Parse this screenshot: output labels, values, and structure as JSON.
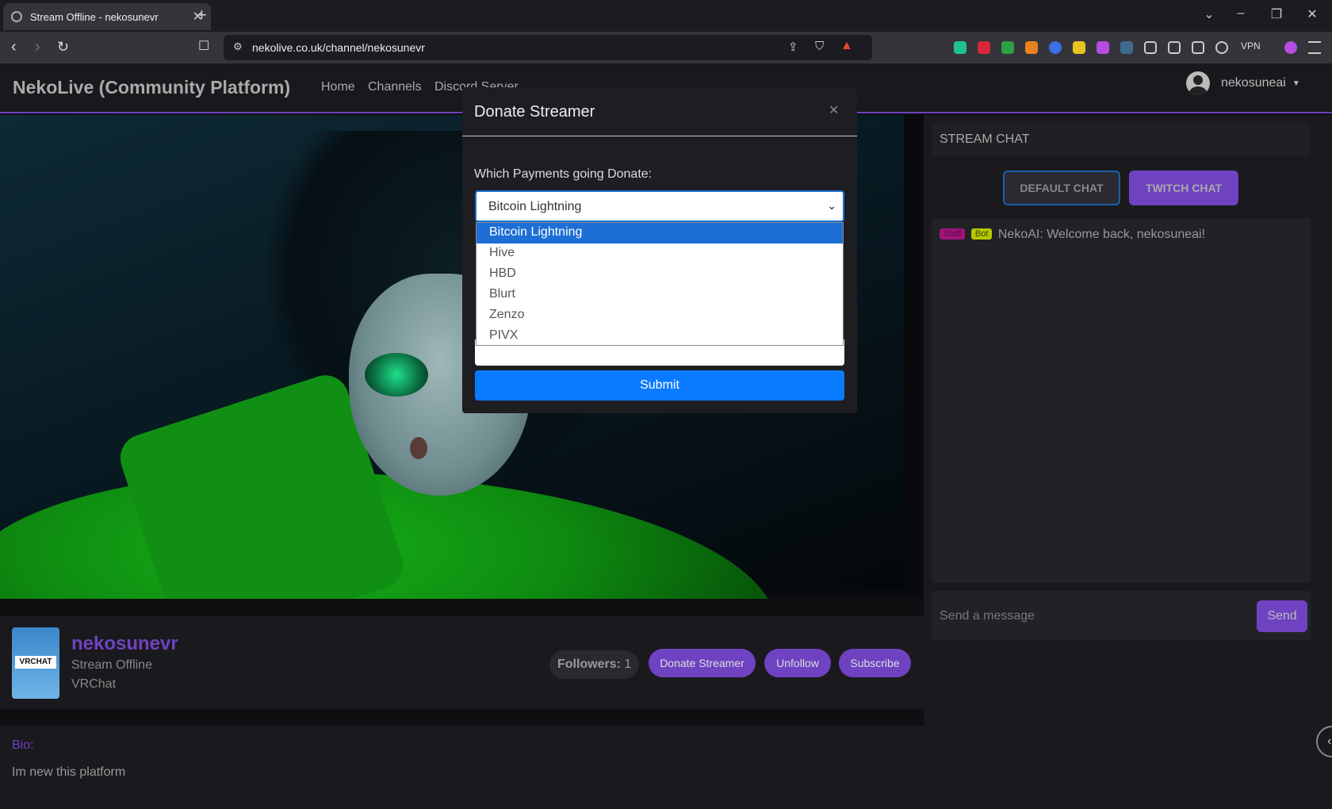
{
  "browser": {
    "tab_title": "Stream Offline - nekosunevr",
    "url": "nekolive.co.uk/channel/nekosunevr",
    "vpn_label": "VPN"
  },
  "header": {
    "brand": "NekoLive (Community Platform)",
    "nav": [
      "Home",
      "Channels",
      "Discord Server"
    ],
    "username": "nekosuneai"
  },
  "channel": {
    "name": "nekosunevr",
    "status": "Stream Offline",
    "game": "VRChat",
    "logo_text": "VRCHAT",
    "followers_label": "Followers:",
    "followers_count": "1",
    "buttons": [
      "Donate Streamer",
      "Unfollow",
      "Subscribe"
    ],
    "bio_label": "Bio:",
    "bio": "Im new this platform"
  },
  "chat": {
    "title": "STREAM CHAT",
    "default_label": "DEFAULT CHAT",
    "twitch_label": "TWITCH CHAT",
    "message": {
      "badges": [
        {
          "text": "Staff",
          "bg": "#a0147a",
          "color": "#5a0a45"
        },
        {
          "text": "Bot",
          "bg": "#b5c800",
          "color": "#3d4200"
        }
      ],
      "text": "NekoAI: Welcome back, nekosuneai!"
    },
    "input_placeholder": "Send a message",
    "send_label": "Send"
  },
  "modal": {
    "title": "Donate Streamer",
    "label": "Which Payments going Donate:",
    "selected": "Bitcoin Lightning",
    "options": [
      "Bitcoin Lightning",
      "Hive",
      "HBD",
      "Blurt",
      "Zenzo",
      "PIVX"
    ],
    "submit_label": "Submit"
  },
  "colors": {
    "accent": "#6f42c1",
    "primary": "#0a7bff",
    "select_highlight": "#1d6fd6"
  }
}
